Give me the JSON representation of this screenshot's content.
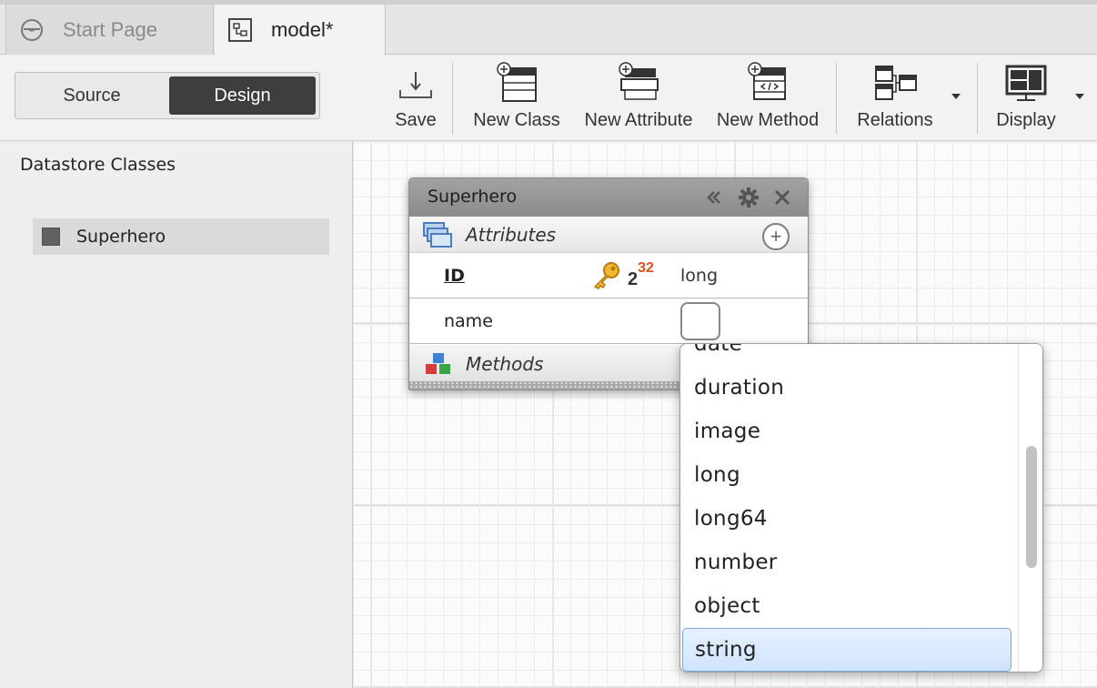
{
  "tabs": [
    {
      "label": "Start Page",
      "icon": "start-page-icon",
      "active": false
    },
    {
      "label": "model*",
      "icon": "model-diagram-icon",
      "active": true
    }
  ],
  "toolbar": {
    "view_toggle": {
      "source": "Source",
      "design": "Design",
      "selected": "Design"
    },
    "buttons": [
      {
        "label": "Save",
        "icon": "save-icon"
      },
      {
        "label": "New Class",
        "icon": "new-class-icon"
      },
      {
        "label": "New Attribute",
        "icon": "new-attribute-icon"
      },
      {
        "label": "New Method",
        "icon": "new-method-icon"
      },
      {
        "label": "Relations",
        "icon": "relations-icon"
      },
      {
        "label": "Display",
        "icon": "display-icon"
      }
    ]
  },
  "left_panel": {
    "title": "Datastore Classes",
    "classes": [
      "Superhero"
    ]
  },
  "class_box": {
    "title": "Superhero",
    "attributes_label": "Attributes",
    "methods_label": "Methods",
    "attributes": [
      {
        "name": "ID",
        "type": "long",
        "primary_key": true,
        "autoincrement_badge": "2",
        "autoincrement_exp": "32"
      },
      {
        "name": "name",
        "type": ""
      }
    ]
  },
  "type_dropdown": {
    "items": [
      "date",
      "duration",
      "image",
      "long",
      "long64",
      "number",
      "object",
      "string"
    ],
    "selected": "string"
  },
  "colors": {
    "selected_toggle": "#3e3e3e",
    "dropdown_selection": "#d6e8ff",
    "autoincrement_exponent": "#e0501e",
    "key_icon": "#e3a21a"
  }
}
